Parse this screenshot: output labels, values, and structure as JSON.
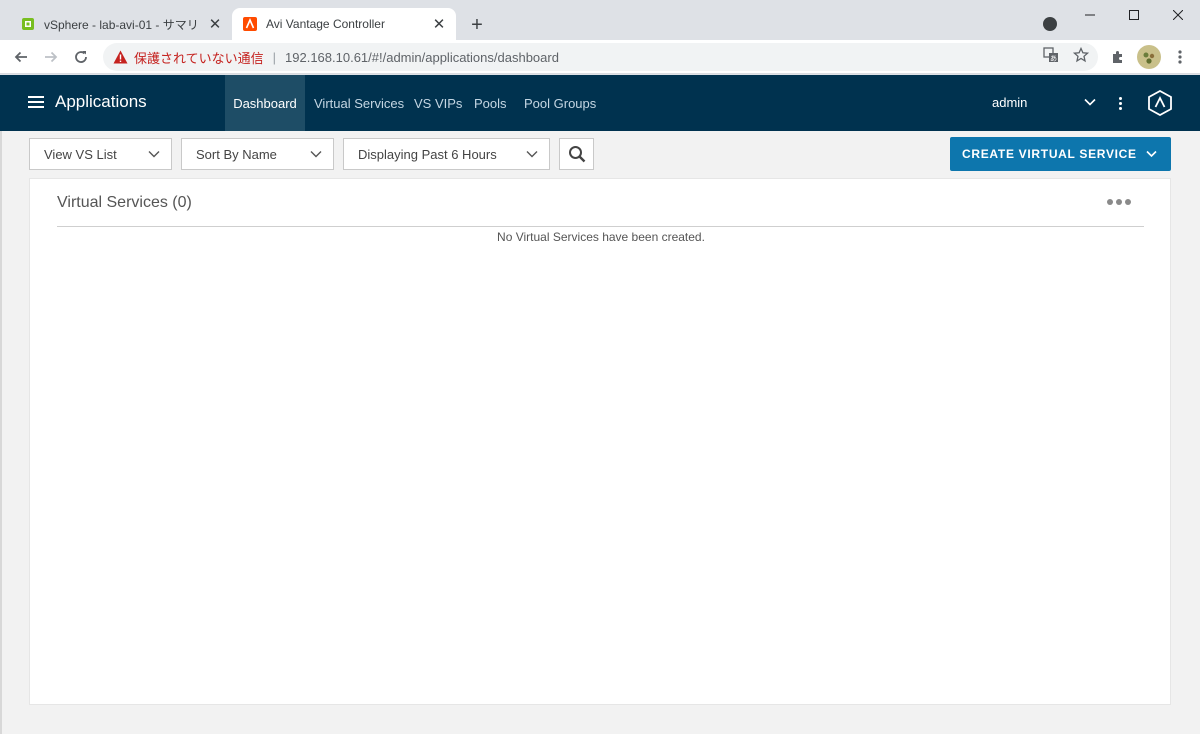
{
  "browser": {
    "tabs": [
      {
        "title": "vSphere - lab-avi-01 - サマリ",
        "active": false,
        "favicon": "vsphere-icon",
        "favicon_color": "#78be20"
      },
      {
        "title": "Avi Vantage Controller",
        "active": true,
        "favicon": "avi-icon",
        "favicon_color": "#ff4b00"
      }
    ],
    "address": {
      "security_label": "保護されていない通信",
      "url": "192.168.10.61/#!/admin/applications/dashboard"
    }
  },
  "app": {
    "title": "Applications",
    "nav_tabs": [
      {
        "label": "Dashboard",
        "active": true
      },
      {
        "label": "Virtual Services",
        "active": false
      },
      {
        "label": "VS VIPs",
        "active": false
      },
      {
        "label": "Pools",
        "active": false
      },
      {
        "label": "Pool Groups",
        "active": false
      }
    ],
    "user": "admin",
    "header_color": "#00324f",
    "accent_color": "#0d76ad"
  },
  "controls": {
    "view_select": "View VS List",
    "sort_select": "Sort By Name",
    "time_select": "Displaying Past 6 Hours",
    "create_button": "CREATE VIRTUAL SERVICE"
  },
  "panel": {
    "title": "Virtual Services (0)",
    "empty_message": "No Virtual Services have been created."
  }
}
